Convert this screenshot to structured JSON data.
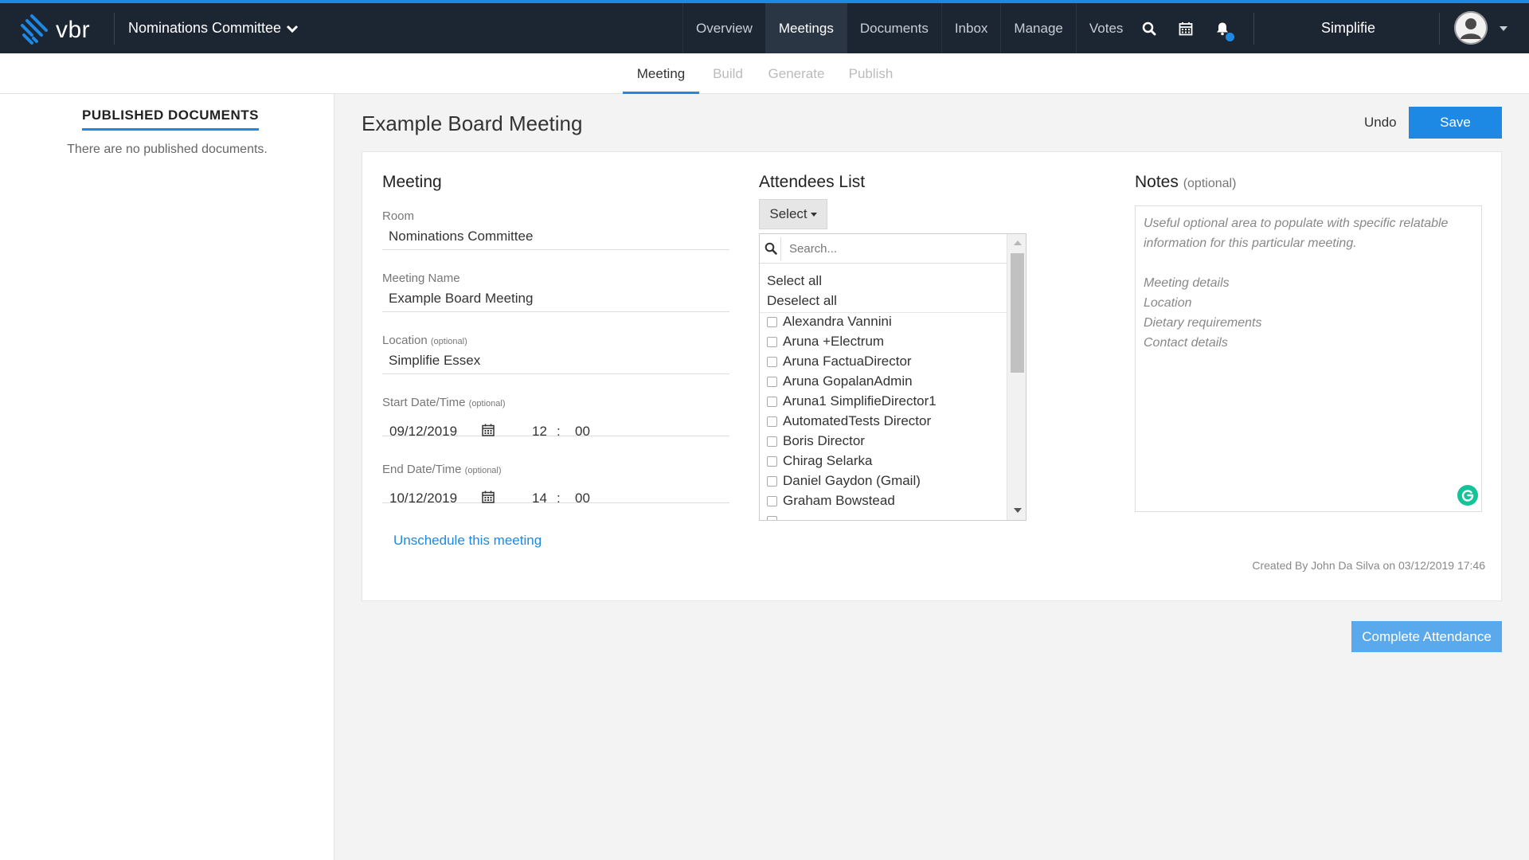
{
  "brand": {
    "logo_text": "vbr",
    "accent": "#1e88e5",
    "topbar_bg": "#1c2633"
  },
  "header": {
    "committee": "Nominations Committee",
    "nav": [
      "Overview",
      "Meetings",
      "Documents",
      "Inbox",
      "Manage",
      "Votes"
    ],
    "active_nav": "Meetings",
    "org_name": "Simplifie"
  },
  "subnav": {
    "tabs": [
      "Meeting",
      "Build",
      "Generate",
      "Publish"
    ],
    "active": "Meeting"
  },
  "sidebar": {
    "title": "PUBLISHED DOCUMENTS",
    "empty_message": "There are no published documents."
  },
  "page": {
    "title": "Example Board Meeting",
    "undo_label": "Undo",
    "save_label": "Save"
  },
  "meeting": {
    "heading": "Meeting",
    "room_label": "Room",
    "room_value": "Nominations Committee",
    "name_label": "Meeting Name",
    "name_value": "Example Board Meeting",
    "location_label": "Location",
    "location_optional": "(optional)",
    "location_value": "Simplifie Essex",
    "start_label": "Start Date/Time",
    "start_optional": "(optional)",
    "start_date": "09/12/2019",
    "start_hour": "12",
    "start_min": "00",
    "end_label": "End Date/Time",
    "end_optional": "(optional)",
    "end_date": "10/12/2019",
    "end_hour": "14",
    "end_min": "00",
    "time_sep": ":",
    "unschedule_label": "Unschedule this meeting"
  },
  "attendees": {
    "heading": "Attendees List",
    "select_label": "Select",
    "search_placeholder": "Search...",
    "select_all": "Select all",
    "deselect_all": "Deselect all",
    "items": [
      "Alexandra Vannini",
      "Aruna +Electrum",
      "Aruna FactuaDirector",
      "Aruna GopalanAdmin",
      "Aruna1 SimplifieDirector1",
      "AutomatedTests Director",
      "Boris Director",
      "Chirag Selarka",
      "Daniel Gaydon (Gmail)",
      "Graham Bowstead"
    ]
  },
  "notes": {
    "heading": "Notes",
    "optional": "(optional)",
    "line1": "Useful optional area to populate with specific relatable information for this particular meeting.",
    "line2": "Meeting details",
    "line3": "Location",
    "line4": "Dietary requirements",
    "line5": "Contact details",
    "created_by": "Created By John Da Silva on 03/12/2019 17:46"
  },
  "footer": {
    "complete_label": "Complete Attendance"
  }
}
